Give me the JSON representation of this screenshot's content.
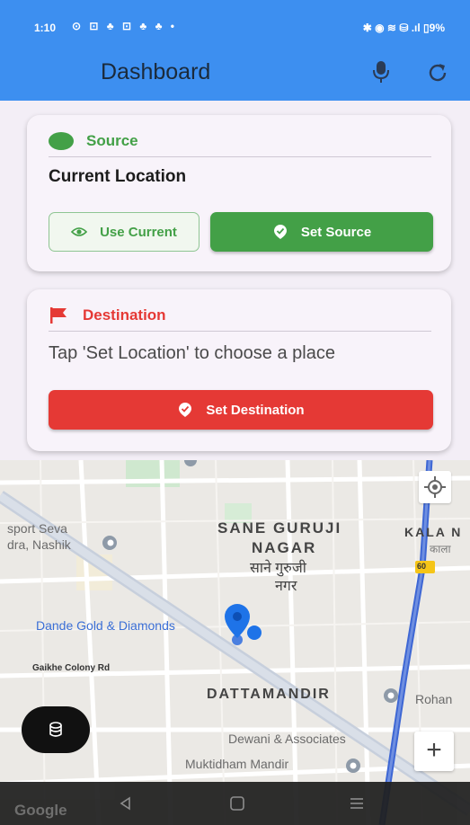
{
  "status": {
    "time": "1:10",
    "battery": "9%"
  },
  "appbar": {
    "title": "Dashboard"
  },
  "source_card": {
    "header": "Source",
    "value": "Current Location",
    "use_current_label": "Use Current",
    "set_source_label": "Set Source"
  },
  "destination_card": {
    "header": "Destination",
    "value": "Tap 'Set Location' to choose a place",
    "set_destination_label": "Set Destination"
  },
  "map": {
    "labels": {
      "sport_seva": "sport Seva",
      "nashik": "dra, Nashik",
      "sane_guruji_1": "SANE GURUJI",
      "sane_guruji_2": "NAGAR",
      "sane_dev_1": "साने गुरुजी",
      "sane_dev_2": "नगर",
      "kala": "KALA N",
      "kala_dev": "काला",
      "dande": "Dande Gold & Diamonds",
      "gaikhe": "Gaikhe Colony Rd",
      "dattamandir": "DATTAMANDIR",
      "rohan": "Rohan",
      "dewani": "Dewani & Associates",
      "muktidham": "Muktidham Mandir",
      "road_shield": "60"
    },
    "attribution": "Google",
    "zoom_in": "+"
  },
  "colors": {
    "appbar": "#3d8ff0",
    "green": "#43a047",
    "red": "#e53935"
  }
}
